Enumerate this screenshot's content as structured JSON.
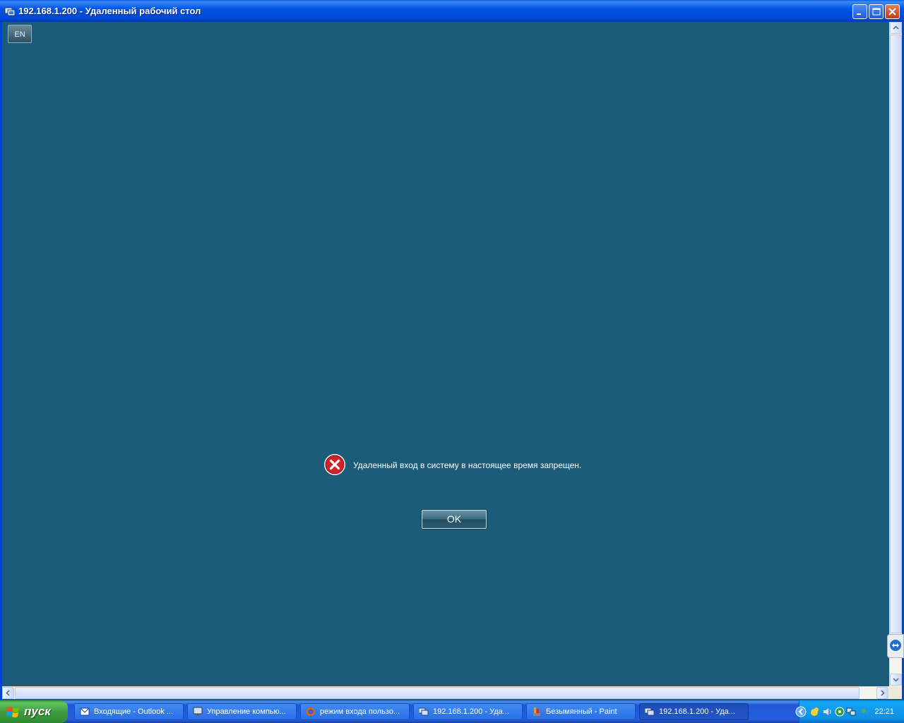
{
  "window": {
    "title": "192.168.1.200 - Удаленный рабочий стол",
    "icon": "remote-desktop-icon",
    "controls": [
      "minimize",
      "maximize",
      "close"
    ]
  },
  "remote_screen": {
    "background_color": "#1a5c7a",
    "language_indicator": "EN",
    "error_message": "Удаленный вход в систему в настоящее время запрещен.",
    "ok_button": "OK"
  },
  "taskbar": {
    "start_label": "пуск",
    "tasks": [
      {
        "label": "Входящие - Outlook ...",
        "icon": "outlook-icon",
        "active": false
      },
      {
        "label": "Управление компью...",
        "icon": "computer-management-icon",
        "active": false
      },
      {
        "label": "режим входа пользо...",
        "icon": "firefox-icon",
        "active": false
      },
      {
        "label": "192.168.1.200 - Уда...",
        "icon": "remote-desktop-icon",
        "active": false
      },
      {
        "label": "Безымянный - Paint",
        "icon": "paint-icon",
        "active": false
      },
      {
        "label": "192.168.1.200 - Уда...",
        "icon": "remote-desktop-icon",
        "active": true
      }
    ],
    "clock": "22:21"
  }
}
